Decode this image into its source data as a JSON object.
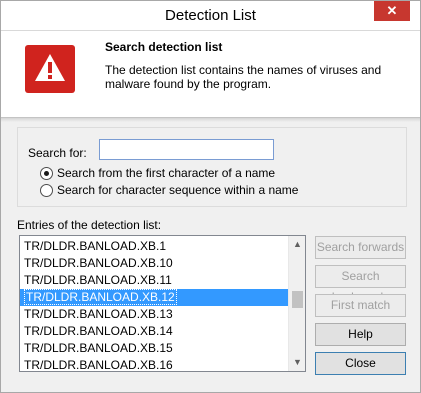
{
  "window": {
    "title": "Detection List",
    "close_glyph": "✕"
  },
  "header": {
    "title": "Search detection list",
    "description": "The detection list contains the names of viruses and malware found by the program.",
    "icon": "warning-icon",
    "accent": "#d0231e"
  },
  "search": {
    "label": "Search for:",
    "value": "",
    "options": [
      {
        "label": "Search from the first character of a name",
        "checked": true
      },
      {
        "label": "Search for character sequence within a name",
        "checked": false
      }
    ]
  },
  "list": {
    "label": "Entries of the detection list:",
    "items": [
      "TR/DLDR.BANLOAD.XB.1",
      "TR/DLDR.BANLOAD.XB.10",
      "TR/DLDR.BANLOAD.XB.11",
      "TR/DLDR.BANLOAD.XB.12",
      "TR/DLDR.BANLOAD.XB.13",
      "TR/DLDR.BANLOAD.XB.14",
      "TR/DLDR.BANLOAD.XB.15",
      "TR/DLDR.BANLOAD.XB.16"
    ],
    "selected_index": 3
  },
  "buttons": {
    "search_forwards": "Search forwards",
    "search_backwards": "Search backwards",
    "first_match": "First match",
    "help": "Help",
    "close": "Close"
  }
}
